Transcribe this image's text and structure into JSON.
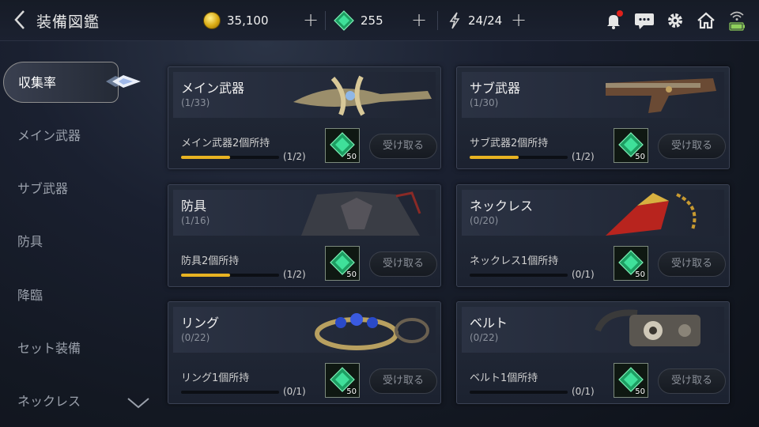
{
  "header": {
    "title": "装備図鑑",
    "gold": "35,100",
    "gems": "255",
    "stamina": "24/24",
    "plus": "+"
  },
  "sidebar": {
    "items": [
      {
        "label": "収集率",
        "active": true
      },
      {
        "label": "メイン武器",
        "active": false
      },
      {
        "label": "サブ武器",
        "active": false
      },
      {
        "label": "防具",
        "active": false
      },
      {
        "label": "降臨",
        "active": false
      },
      {
        "label": "セット装備",
        "active": false
      },
      {
        "label": "ネックレス",
        "active": false
      }
    ]
  },
  "cards": [
    {
      "title": "メイン武器",
      "count": "(1/33)",
      "task": "メイン武器2個所持",
      "progress_text": "(1/2)",
      "progress": 0.5,
      "reward_qty": "50",
      "button": "受け取る"
    },
    {
      "title": "サブ武器",
      "count": "(1/30)",
      "task": "サブ武器2個所持",
      "progress_text": "(1/2)",
      "progress": 0.5,
      "reward_qty": "50",
      "button": "受け取る"
    },
    {
      "title": "防具",
      "count": "(1/16)",
      "task": "防具2個所持",
      "progress_text": "(1/2)",
      "progress": 0.5,
      "reward_qty": "50",
      "button": "受け取る"
    },
    {
      "title": "ネックレス",
      "count": "(0/20)",
      "task": "ネックレス1個所持",
      "progress_text": "(0/1)",
      "progress": 0,
      "reward_qty": "50",
      "button": "受け取る"
    },
    {
      "title": "リング",
      "count": "(0/22)",
      "task": "リング1個所持",
      "progress_text": "(0/1)",
      "progress": 0,
      "reward_qty": "50",
      "button": "受け取る"
    },
    {
      "title": "ベルト",
      "count": "(0/22)",
      "task": "ベルト1個所持",
      "progress_text": "(0/1)",
      "progress": 0,
      "reward_qty": "50",
      "button": "受け取る"
    }
  ],
  "icons": {
    "back": "back-arrow-icon",
    "gold": "gold-coin-icon",
    "gem": "green-gem-icon",
    "stamina": "stamina-icon",
    "notification": "bell-icon",
    "chat": "chat-icon",
    "settings": "gear-icon",
    "home": "home-icon",
    "signal": "wifi-battery-icon"
  },
  "colors": {
    "progress": "#e8b322",
    "notification_dot": "#e0211b",
    "gem": "#2fd08a"
  }
}
